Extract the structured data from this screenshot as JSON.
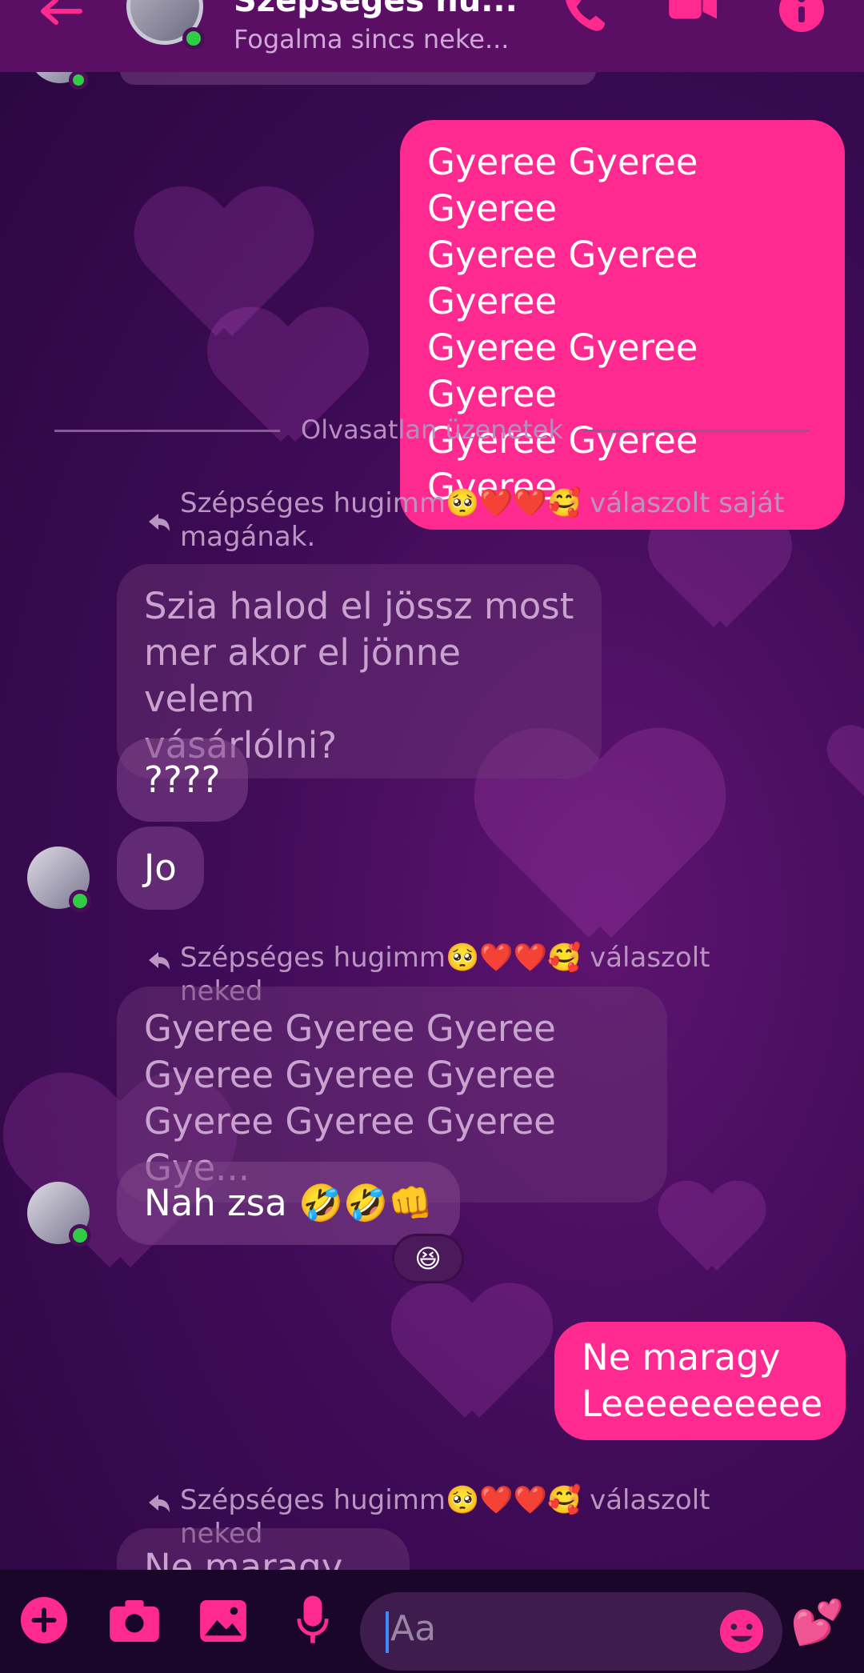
{
  "header": {
    "title": "Szépséges hu...",
    "subtitle": "Fogalma sincs neke..."
  },
  "messages": {
    "out1": [
      "Gyeree Gyeree Gyeree",
      "Gyeree Gyeree Gyeree",
      "Gyeree Gyeree Gyeree",
      "Gyeree Gyeree Gyeree"
    ],
    "divider": "Olvasatlan üzenetek",
    "reply_note_1": "Szépséges hugimm🥺❤️❤️🥰 válaszolt saját magának.",
    "in_reply_1": [
      "Szia halod el jössz most",
      "mer akor el jönne velem",
      "vásárlólni?"
    ],
    "in1": "????",
    "in2": "Jo",
    "reply_note_2": "Szépséges hugimm🥺❤️❤️🥰 válaszolt neked",
    "in_reply_2": [
      "Gyeree Gyeree Gyeree",
      "Gyeree Gyeree Gyeree",
      "Gyeree Gyeree Gyeree Gye..."
    ],
    "in3": "Nah zsa 🤣🤣👊",
    "reaction": "😆",
    "out2": [
      "Ne maragy",
      "Leeeeeeeeee"
    ],
    "reply_note_3": "Szépséges hugimm🥺❤️❤️🥰 válaszolt neked",
    "in_reply_3": "Ne maragy..."
  },
  "composer": {
    "placeholder": "Aa",
    "like_emoji": "💕"
  },
  "colors": {
    "accent": "#ff2a8f",
    "header_bg": "#5a0f64",
    "composer_bg": "#190628"
  },
  "icons": {
    "back": "back-arrow-icon",
    "phone": "phone-icon",
    "video": "video-camera-icon",
    "info": "info-icon",
    "plus": "plus-icon",
    "camera": "camera-icon",
    "gallery": "image-icon",
    "mic": "microphone-icon",
    "emoji": "emoji-icon",
    "heart": "heart-icon"
  }
}
